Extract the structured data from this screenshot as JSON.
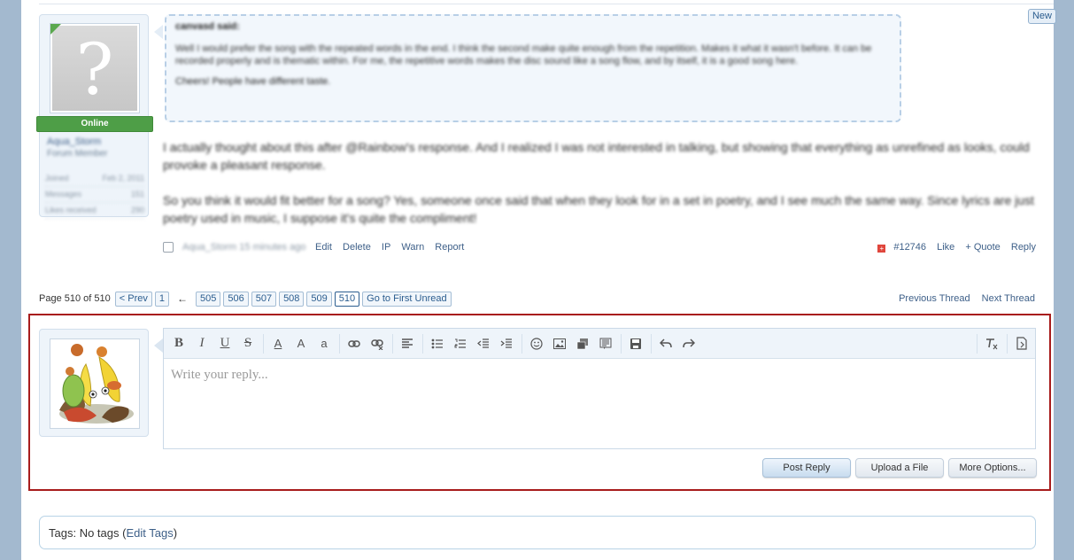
{
  "post": {
    "new_badge": "New",
    "user": {
      "status": "Online",
      "name": "Aqua_Storm",
      "title": "Forum Member",
      "stats": [
        {
          "label": "Joined",
          "value": "Feb 2, 2011"
        },
        {
          "label": "Messages",
          "value": "151"
        },
        {
          "label": "Likes received",
          "value": "290"
        }
      ]
    },
    "quote": {
      "header": "canvasd said:",
      "body": "Well I would prefer the song with the repeated words in the end. I think the second make quite enough from the repetition. Makes it what it wasn't before. It can be recorded properly and is thematic within. For me, the repetitive words makes the disc sound like a song flow, and by itself, it is a good song here.",
      "footer": "Cheers! People have different taste."
    },
    "message": [
      "I actually thought about this after @Rainbow's response. And I realized I was not interested in talking, but showing that everything as unrefined as looks, could provoke a pleasant response.",
      "So you think it would fit better for a song? Yes, someone once said that when they look for in a set in poetry, and I see much the same way. Since lyrics are just poetry used in music, I suppose it's quite the compliment!"
    ],
    "footer": {
      "meta_author": "Aqua_Storm",
      "meta_time": "15 minutes ago",
      "links": [
        "Edit",
        "Delete",
        "IP",
        "Warn",
        "Report"
      ],
      "post_number": "#12746",
      "like": "Like",
      "quote": "+ Quote",
      "reply": "Reply"
    }
  },
  "pagination": {
    "label": "Page 510 of 510",
    "prev": "< Prev",
    "first": "1",
    "arrow": "←",
    "pages": [
      "505",
      "506",
      "507",
      "508",
      "509",
      "510"
    ],
    "current": "510",
    "goto_unread": "Go to First Unread",
    "previous_thread": "Previous Thread",
    "next_thread": "Next Thread"
  },
  "quick_reply": {
    "placeholder": "Write your reply...",
    "toolbar": {
      "bold": "B",
      "italic": "I",
      "underline": "U",
      "strike": "S",
      "font_color": "A",
      "font_size": "A",
      "font_family": "a"
    },
    "buttons": {
      "post_reply": "Post Reply",
      "upload": "Upload a File",
      "more": "More Options..."
    }
  },
  "tags": {
    "label": "Tags:",
    "value": "No tags",
    "edit": "Edit Tags"
  }
}
